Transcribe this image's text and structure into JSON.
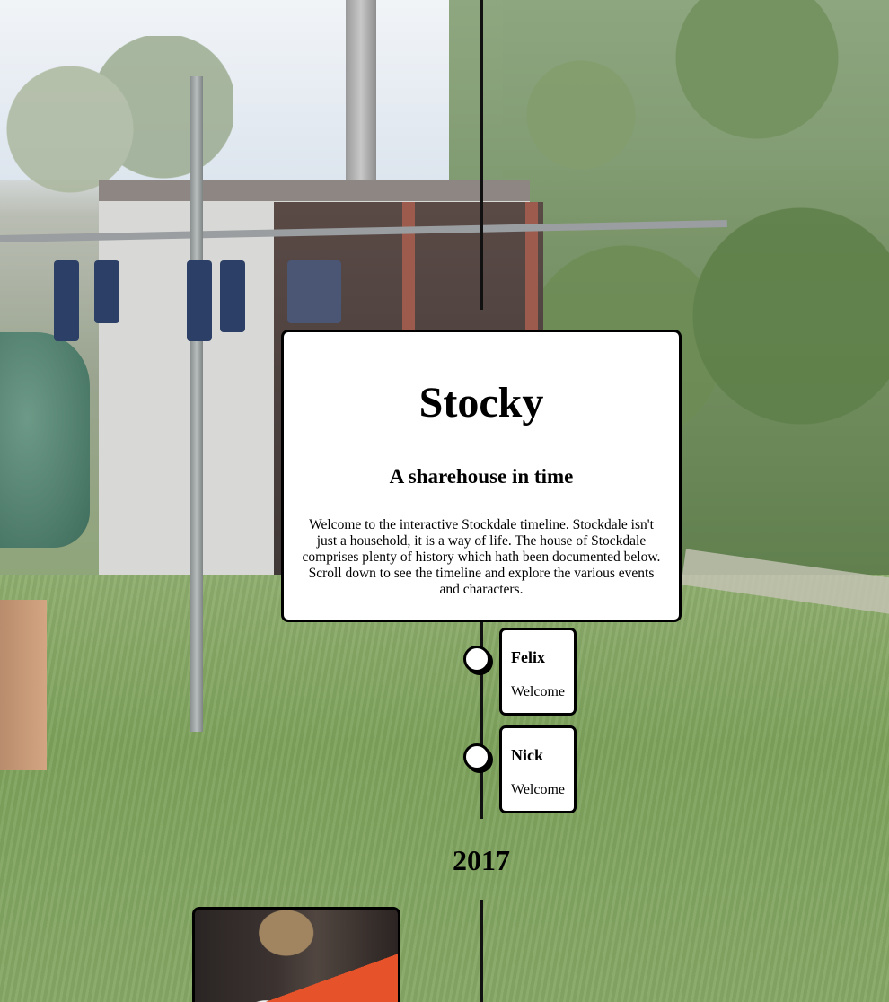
{
  "intro": {
    "title": "Stocky",
    "subtitle": "A sharehouse in time",
    "description": "Welcome to the interactive Stockdale timeline. Stockdale isn't just a household, it is a way of life. The house of Stockdale comprises plenty of history which hath been documented below. Scroll down to see the timeline and explore the various events and characters."
  },
  "events": [
    {
      "name": "Felix",
      "note": "Welcome"
    },
    {
      "name": "Nick",
      "note": "Welcome"
    }
  ],
  "year_label": "2017",
  "colors": {
    "timeline_line": "#111111",
    "card_background": "#ffffff",
    "card_border": "#000000"
  },
  "icons": {
    "timeline_marker": "circle-marker-icon"
  }
}
